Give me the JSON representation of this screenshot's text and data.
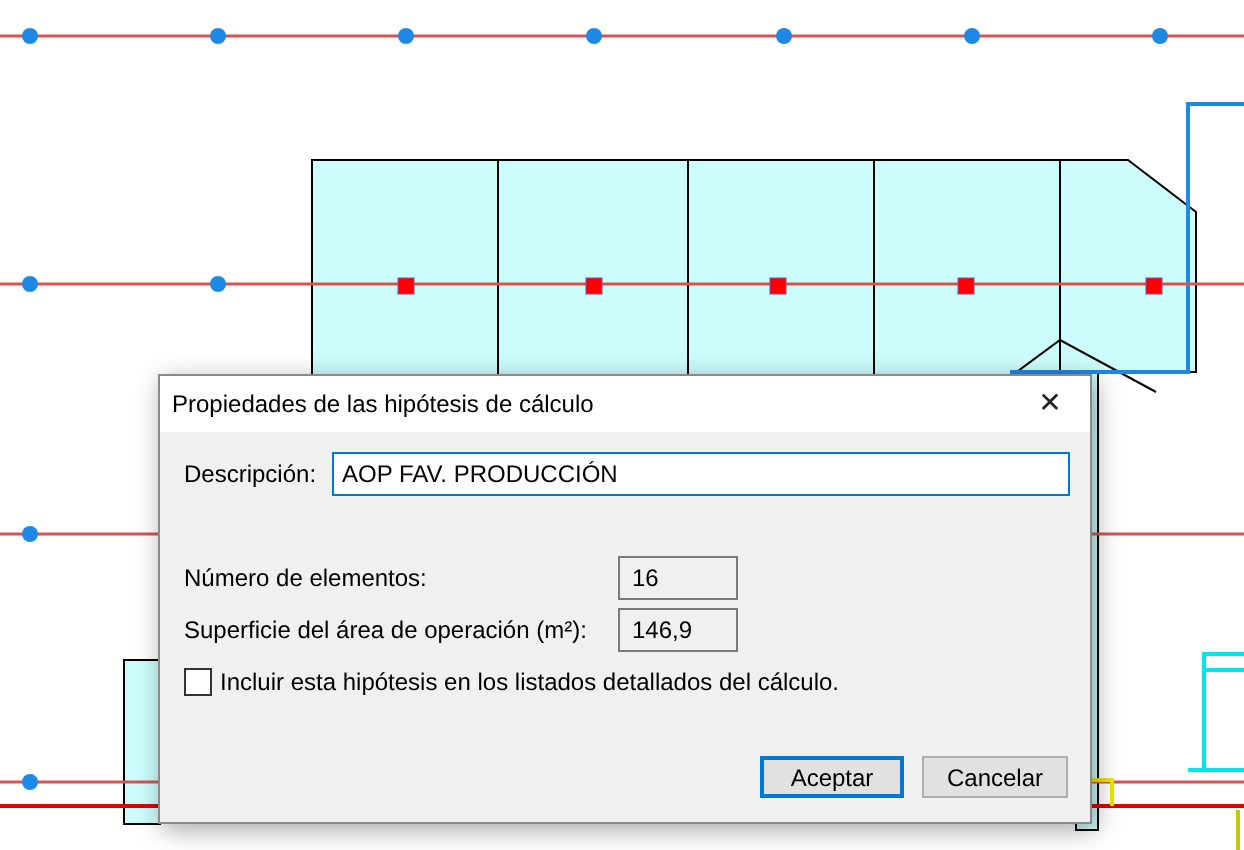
{
  "dialog": {
    "title": "Propiedades de las hipótesis de cálculo",
    "close": "✕",
    "description": {
      "label": "Descripción:",
      "value": "AOP FAV. PRODUCCIÓN"
    },
    "fields": [
      {
        "label": "Número de elementos:",
        "value": "16"
      },
      {
        "label": "Superficie del área de operación (m²):",
        "value": "146,9"
      }
    ],
    "checkbox": {
      "label": "Incluir esta hipótesis en los listados detallados del cálculo.",
      "checked": false
    },
    "buttons": [
      {
        "label": "Aceptar",
        "default": true
      },
      {
        "label": "Cancelar",
        "default": false
      }
    ]
  }
}
